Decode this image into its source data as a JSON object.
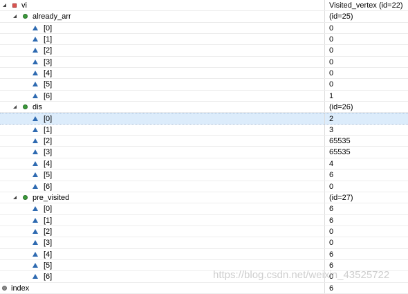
{
  "variables": {
    "vi": {
      "name": "vi",
      "value": "Visited_vertex  (id=22)"
    },
    "already_arr": {
      "name": "already_arr",
      "value": "(id=25)",
      "elements": [
        {
          "index": "[0]",
          "value": "0"
        },
        {
          "index": "[1]",
          "value": "0"
        },
        {
          "index": "[2]",
          "value": "0"
        },
        {
          "index": "[3]",
          "value": "0"
        },
        {
          "index": "[4]",
          "value": "0"
        },
        {
          "index": "[5]",
          "value": "0"
        },
        {
          "index": "[6]",
          "value": "1"
        }
      ]
    },
    "dis": {
      "name": "dis",
      "value": "(id=26)",
      "elements": [
        {
          "index": "[0]",
          "value": "2"
        },
        {
          "index": "[1]",
          "value": "3"
        },
        {
          "index": "[2]",
          "value": "65535"
        },
        {
          "index": "[3]",
          "value": "65535"
        },
        {
          "index": "[4]",
          "value": "4"
        },
        {
          "index": "[5]",
          "value": "6"
        },
        {
          "index": "[6]",
          "value": "0"
        }
      ]
    },
    "pre_visited": {
      "name": "pre_visited",
      "value": "(id=27)",
      "elements": [
        {
          "index": "[0]",
          "value": "6"
        },
        {
          "index": "[1]",
          "value": "6"
        },
        {
          "index": "[2]",
          "value": "0"
        },
        {
          "index": "[3]",
          "value": "0"
        },
        {
          "index": "[4]",
          "value": "6"
        },
        {
          "index": "[5]",
          "value": "6"
        },
        {
          "index": "[6]",
          "value": "0"
        }
      ]
    },
    "index": {
      "name": "index",
      "value": "6"
    }
  },
  "watermark": "https://blog.csdn.net/weixin_43525722",
  "icons": {
    "expander": "expand-collapse-icon",
    "field_private": "private-field-icon",
    "field_default": "default-field-icon",
    "field_local": "local-variable-icon",
    "array_element": "array-element-icon"
  },
  "colors": {
    "selection": "#dcecfb",
    "element_icon": "#2e6ab1",
    "field_icon": "#3a9a3a",
    "private_icon": "#d9534f"
  }
}
